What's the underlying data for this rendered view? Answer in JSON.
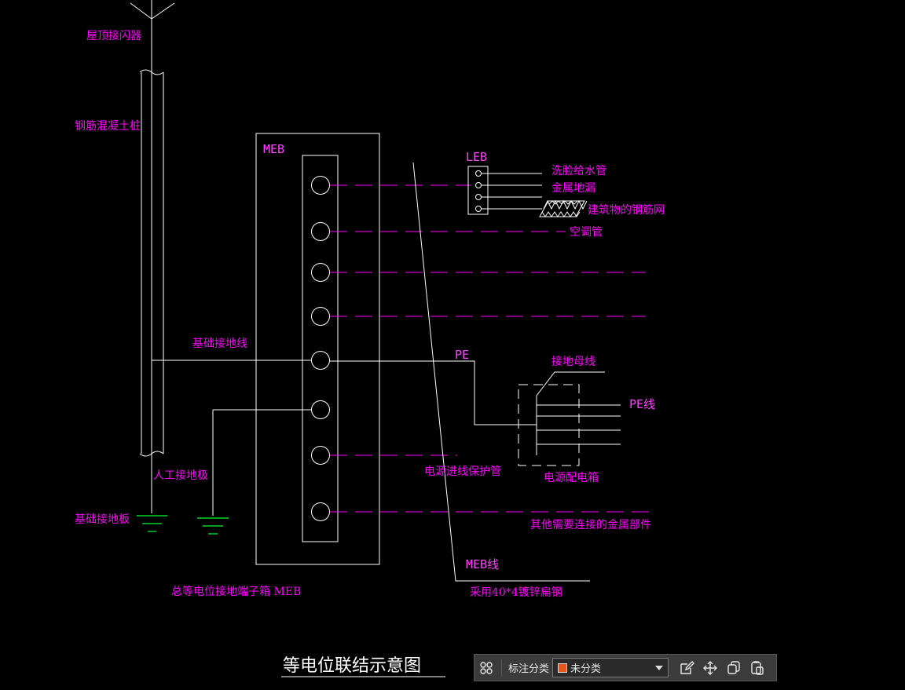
{
  "diagram": {
    "title": "等电位联结示意图",
    "labels": {
      "roof_arrester": "屋顶接闪器",
      "pile": "钢筋混凝土桩",
      "foundation_wire": "基础接地线",
      "artificial_plate": "人工接地极",
      "foundation_plate": "基础接地板",
      "meb_top": "MEB",
      "meb_box_caption": "总等电位接地端子箱 MEB",
      "leb": "LEB",
      "bath_pipe": "洗脸给水管",
      "floor_drain": "金属地漏",
      "rebar_mesh": "建筑物的钢筋网",
      "ac_pipe": "空调管",
      "pe": "PE",
      "ground_bus": "接地母线",
      "pe_line": "PE线",
      "distribution_box": "电源配电箱",
      "power_conduit": "电源进线保护管",
      "other_metal": "其他需要连接的金属部件",
      "meb_line": "MEB线",
      "flat_steel": "采用40*4镀锌扁钢"
    }
  },
  "toolbar": {
    "category_label": "标注分类",
    "selected_category": "未分类",
    "swatch_color": "#e8561e"
  },
  "colors": {
    "magenta": "#ff00ff",
    "line": "#ffffff",
    "ground": "#00ff33",
    "background": "#000000"
  }
}
